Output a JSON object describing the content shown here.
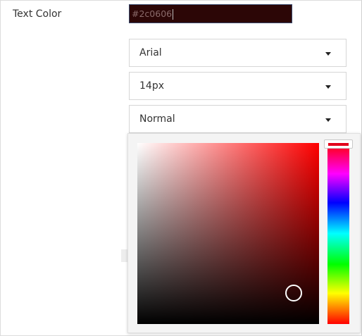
{
  "text_color": {
    "label": "Text Color",
    "value": "#2c0606"
  },
  "font_family_select": {
    "value": "Arial"
  },
  "font_size_select": {
    "value": "14px"
  },
  "font_weight_select": {
    "value": "Normal"
  },
  "color_picker": {
    "hue_color": "#ff0000",
    "selected_color": "#2c0606"
  },
  "icons": {
    "dropdown": "chevron-down-icon"
  }
}
